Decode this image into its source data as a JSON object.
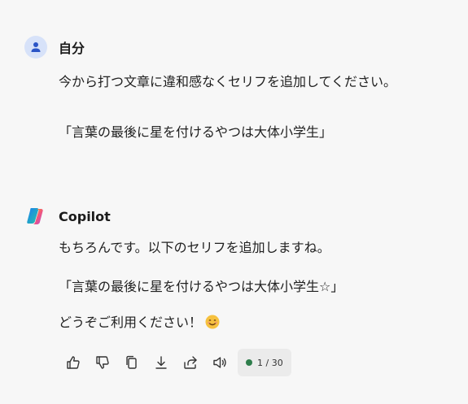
{
  "user_message": {
    "author": "自分",
    "lines": [
      "今から打つ文章に違和感なくセリフを追加してください。",
      "「言葉の最後に星を付けるやつは大体小学生」"
    ]
  },
  "copilot_message": {
    "author": "Copilot",
    "lines": [
      "もちろんです。以下のセリフを追加しますね。",
      "「言葉の最後に星を付けるやつは大体小学生☆」",
      "どうぞご利用ください！"
    ],
    "emoji": "smiling-face-emoji"
  },
  "actions": {
    "icons": [
      "thumbs-up-icon",
      "thumbs-down-icon",
      "copy-icon",
      "download-icon",
      "share-icon",
      "read-aloud-icon"
    ],
    "page_indicator": "1 / 30",
    "status_color": "#2e7d4b"
  },
  "colors": {
    "background": "#f7f7f7",
    "user_avatar_bg": "#d7e2f9",
    "user_avatar_fg": "#2b55c6"
  }
}
